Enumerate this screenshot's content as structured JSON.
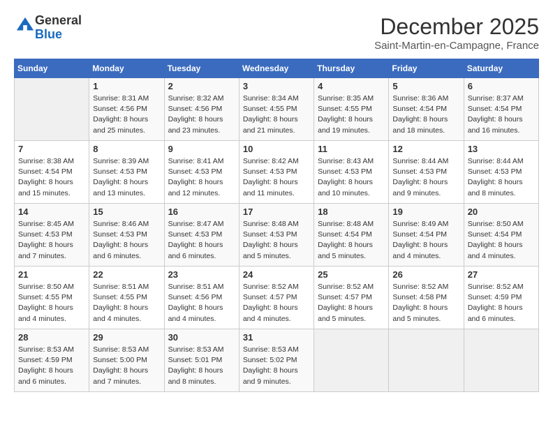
{
  "header": {
    "logo_line1": "General",
    "logo_line2": "Blue",
    "month": "December 2025",
    "location": "Saint-Martin-en-Campagne, France"
  },
  "weekdays": [
    "Sunday",
    "Monday",
    "Tuesday",
    "Wednesday",
    "Thursday",
    "Friday",
    "Saturday"
  ],
  "weeks": [
    [
      {
        "day": "",
        "sunrise": "",
        "sunset": "",
        "daylight": ""
      },
      {
        "day": "1",
        "sunrise": "Sunrise: 8:31 AM",
        "sunset": "Sunset: 4:56 PM",
        "daylight": "Daylight: 8 hours and 25 minutes."
      },
      {
        "day": "2",
        "sunrise": "Sunrise: 8:32 AM",
        "sunset": "Sunset: 4:56 PM",
        "daylight": "Daylight: 8 hours and 23 minutes."
      },
      {
        "day": "3",
        "sunrise": "Sunrise: 8:34 AM",
        "sunset": "Sunset: 4:55 PM",
        "daylight": "Daylight: 8 hours and 21 minutes."
      },
      {
        "day": "4",
        "sunrise": "Sunrise: 8:35 AM",
        "sunset": "Sunset: 4:55 PM",
        "daylight": "Daylight: 8 hours and 19 minutes."
      },
      {
        "day": "5",
        "sunrise": "Sunrise: 8:36 AM",
        "sunset": "Sunset: 4:54 PM",
        "daylight": "Daylight: 8 hours and 18 minutes."
      },
      {
        "day": "6",
        "sunrise": "Sunrise: 8:37 AM",
        "sunset": "Sunset: 4:54 PM",
        "daylight": "Daylight: 8 hours and 16 minutes."
      }
    ],
    [
      {
        "day": "7",
        "sunrise": "Sunrise: 8:38 AM",
        "sunset": "Sunset: 4:54 PM",
        "daylight": "Daylight: 8 hours and 15 minutes."
      },
      {
        "day": "8",
        "sunrise": "Sunrise: 8:39 AM",
        "sunset": "Sunset: 4:53 PM",
        "daylight": "Daylight: 8 hours and 13 minutes."
      },
      {
        "day": "9",
        "sunrise": "Sunrise: 8:41 AM",
        "sunset": "Sunset: 4:53 PM",
        "daylight": "Daylight: 8 hours and 12 minutes."
      },
      {
        "day": "10",
        "sunrise": "Sunrise: 8:42 AM",
        "sunset": "Sunset: 4:53 PM",
        "daylight": "Daylight: 8 hours and 11 minutes."
      },
      {
        "day": "11",
        "sunrise": "Sunrise: 8:43 AM",
        "sunset": "Sunset: 4:53 PM",
        "daylight": "Daylight: 8 hours and 10 minutes."
      },
      {
        "day": "12",
        "sunrise": "Sunrise: 8:44 AM",
        "sunset": "Sunset: 4:53 PM",
        "daylight": "Daylight: 8 hours and 9 minutes."
      },
      {
        "day": "13",
        "sunrise": "Sunrise: 8:44 AM",
        "sunset": "Sunset: 4:53 PM",
        "daylight": "Daylight: 8 hours and 8 minutes."
      }
    ],
    [
      {
        "day": "14",
        "sunrise": "Sunrise: 8:45 AM",
        "sunset": "Sunset: 4:53 PM",
        "daylight": "Daylight: 8 hours and 7 minutes."
      },
      {
        "day": "15",
        "sunrise": "Sunrise: 8:46 AM",
        "sunset": "Sunset: 4:53 PM",
        "daylight": "Daylight: 8 hours and 6 minutes."
      },
      {
        "day": "16",
        "sunrise": "Sunrise: 8:47 AM",
        "sunset": "Sunset: 4:53 PM",
        "daylight": "Daylight: 8 hours and 6 minutes."
      },
      {
        "day": "17",
        "sunrise": "Sunrise: 8:48 AM",
        "sunset": "Sunset: 4:53 PM",
        "daylight": "Daylight: 8 hours and 5 minutes."
      },
      {
        "day": "18",
        "sunrise": "Sunrise: 8:48 AM",
        "sunset": "Sunset: 4:54 PM",
        "daylight": "Daylight: 8 hours and 5 minutes."
      },
      {
        "day": "19",
        "sunrise": "Sunrise: 8:49 AM",
        "sunset": "Sunset: 4:54 PM",
        "daylight": "Daylight: 8 hours and 4 minutes."
      },
      {
        "day": "20",
        "sunrise": "Sunrise: 8:50 AM",
        "sunset": "Sunset: 4:54 PM",
        "daylight": "Daylight: 8 hours and 4 minutes."
      }
    ],
    [
      {
        "day": "21",
        "sunrise": "Sunrise: 8:50 AM",
        "sunset": "Sunset: 4:55 PM",
        "daylight": "Daylight: 8 hours and 4 minutes."
      },
      {
        "day": "22",
        "sunrise": "Sunrise: 8:51 AM",
        "sunset": "Sunset: 4:55 PM",
        "daylight": "Daylight: 8 hours and 4 minutes."
      },
      {
        "day": "23",
        "sunrise": "Sunrise: 8:51 AM",
        "sunset": "Sunset: 4:56 PM",
        "daylight": "Daylight: 8 hours and 4 minutes."
      },
      {
        "day": "24",
        "sunrise": "Sunrise: 8:52 AM",
        "sunset": "Sunset: 4:57 PM",
        "daylight": "Daylight: 8 hours and 4 minutes."
      },
      {
        "day": "25",
        "sunrise": "Sunrise: 8:52 AM",
        "sunset": "Sunset: 4:57 PM",
        "daylight": "Daylight: 8 hours and 5 minutes."
      },
      {
        "day": "26",
        "sunrise": "Sunrise: 8:52 AM",
        "sunset": "Sunset: 4:58 PM",
        "daylight": "Daylight: 8 hours and 5 minutes."
      },
      {
        "day": "27",
        "sunrise": "Sunrise: 8:52 AM",
        "sunset": "Sunset: 4:59 PM",
        "daylight": "Daylight: 8 hours and 6 minutes."
      }
    ],
    [
      {
        "day": "28",
        "sunrise": "Sunrise: 8:53 AM",
        "sunset": "Sunset: 4:59 PM",
        "daylight": "Daylight: 8 hours and 6 minutes."
      },
      {
        "day": "29",
        "sunrise": "Sunrise: 8:53 AM",
        "sunset": "Sunset: 5:00 PM",
        "daylight": "Daylight: 8 hours and 7 minutes."
      },
      {
        "day": "30",
        "sunrise": "Sunrise: 8:53 AM",
        "sunset": "Sunset: 5:01 PM",
        "daylight": "Daylight: 8 hours and 8 minutes."
      },
      {
        "day": "31",
        "sunrise": "Sunrise: 8:53 AM",
        "sunset": "Sunset: 5:02 PM",
        "daylight": "Daylight: 8 hours and 9 minutes."
      },
      {
        "day": "",
        "sunrise": "",
        "sunset": "",
        "daylight": ""
      },
      {
        "day": "",
        "sunrise": "",
        "sunset": "",
        "daylight": ""
      },
      {
        "day": "",
        "sunrise": "",
        "sunset": "",
        "daylight": ""
      }
    ]
  ]
}
